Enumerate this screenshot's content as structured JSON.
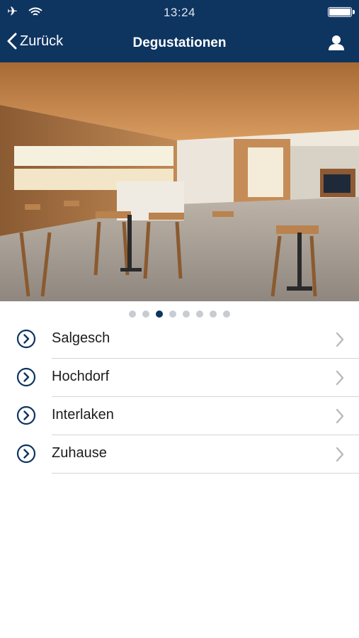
{
  "status_bar": {
    "time": "13:24"
  },
  "nav": {
    "back_label": "Zurück",
    "title": "Degustationen"
  },
  "carousel": {
    "page_count": 8,
    "active_index": 2
  },
  "locations": [
    {
      "label": "Salgesch"
    },
    {
      "label": "Hochdorf"
    },
    {
      "label": "Interlaken"
    },
    {
      "label": "Zuhause"
    }
  ],
  "colors": {
    "nav_bg": "#0e3460",
    "accent": "#0e3460",
    "chevron": "#b9b9b9",
    "separator": "#d4d4d4"
  }
}
